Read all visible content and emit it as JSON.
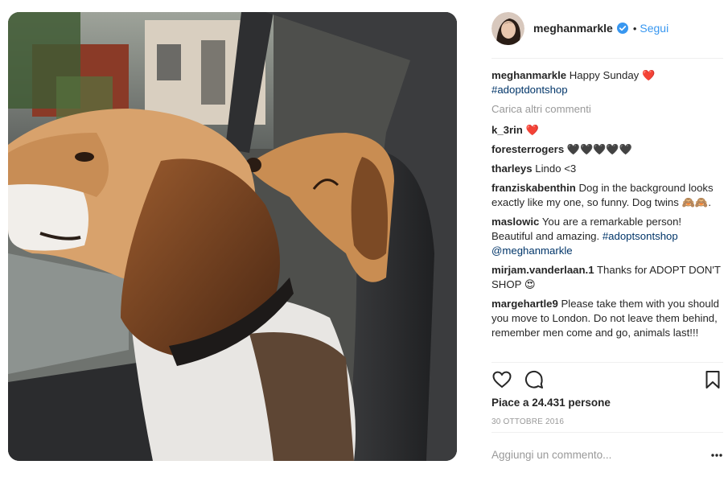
{
  "post": {
    "image_alt": "",
    "author": {
      "handle": "meghanmarkle",
      "verified": true,
      "separator": "•",
      "follow_label": "Segui"
    },
    "caption": {
      "user": "meghanmarkle",
      "text": "Happy Sunday",
      "emoji": "❤️",
      "hashtag": "#adoptdontshop"
    },
    "load_more_label": "Carica altri commenti",
    "comments": [
      {
        "user": "k_3rin",
        "text": "",
        "emoji": "❤️"
      },
      {
        "user": "foresterrogers",
        "text": "",
        "emoji": "🖤🖤🖤🖤🖤"
      },
      {
        "user": "tharleys",
        "text": "Lindo <3",
        "emoji": ""
      },
      {
        "user": "franziskabenthin",
        "text": "Dog in the background looks exactly like my one, so funny. Dog twins",
        "emoji": "🙈🙈."
      },
      {
        "user": "maslowic",
        "text": "You are a remarkable person! Beautiful and amazing.",
        "hashtag": "#adoptsontshop",
        "mention": "@meghanmarkle"
      },
      {
        "user": "mirjam.vanderlaan.1",
        "text": "Thanks for ADOPT DON'T SHOP",
        "emoji": "😍"
      },
      {
        "user": "margehartle9",
        "text": "Please take them with you should you move to London. Do not leave them behind, remember men come and go, animals last!!!",
        "emoji": ""
      }
    ],
    "likes_label": "Piace a 24.431 persone",
    "date": "30 OTTOBRE 2016",
    "add_comment_placeholder": "Aggiungi un commento...",
    "icons": {
      "like": "heart-outline-icon",
      "comment": "speech-bubble-icon",
      "save": "bookmark-icon",
      "more": "more-dots-icon",
      "verified": "verified-badge-icon"
    },
    "colors": {
      "link": "#3897f0",
      "hashtag": "#003569",
      "muted": "#999999",
      "heart": "#d9164e"
    }
  }
}
